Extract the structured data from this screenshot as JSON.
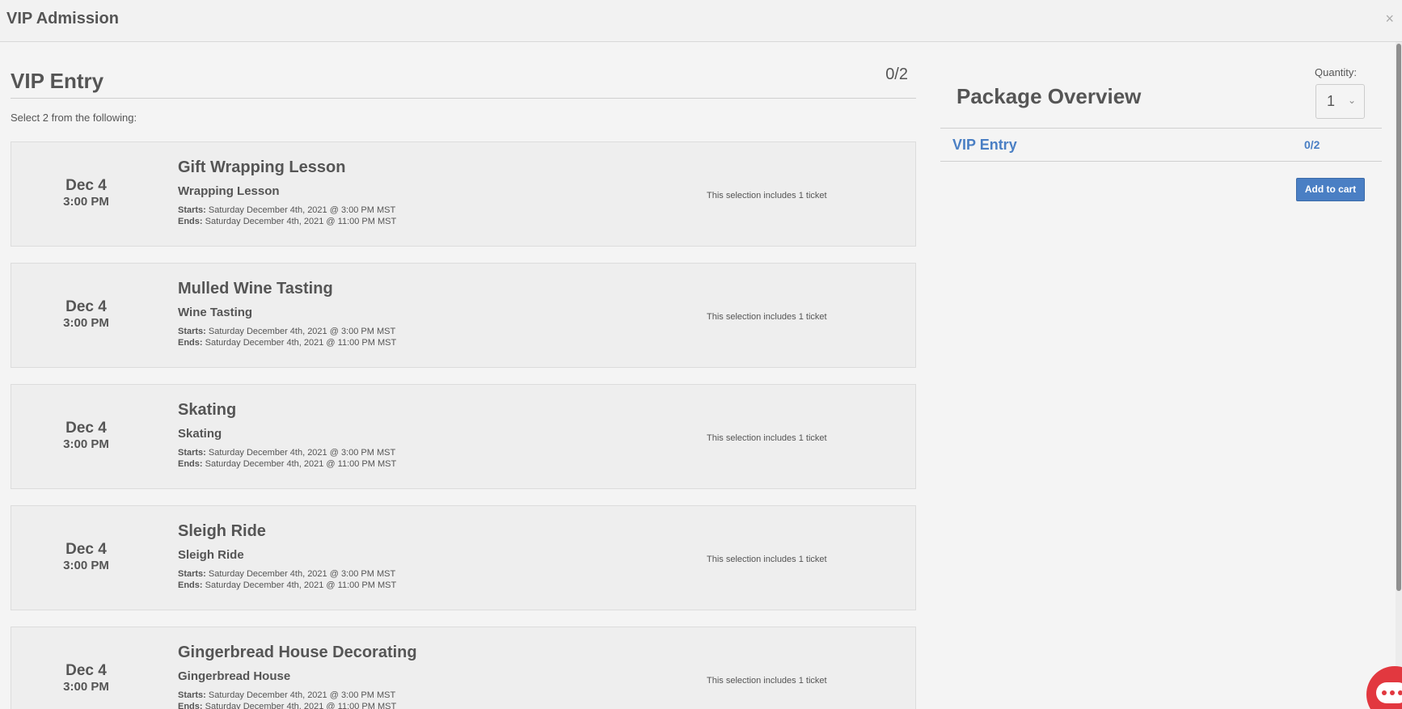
{
  "modal": {
    "title": "VIP Admission",
    "close_label": "×"
  },
  "section": {
    "title": "VIP Entry",
    "count": "0/2",
    "hint": "Select 2 from the following:"
  },
  "events": [
    {
      "date": "Dec 4",
      "time": "3:00 PM",
      "name": "Gift Wrapping Lesson",
      "subtitle": "Wrapping Lesson",
      "starts_label": "Starts:",
      "starts": "Saturday December 4th, 2021 @ 3:00 PM MST",
      "ends_label": "Ends:",
      "ends": "Saturday December 4th, 2021 @ 11:00 PM MST",
      "includes": "This selection includes 1 ticket"
    },
    {
      "date": "Dec 4",
      "time": "3:00 PM",
      "name": "Mulled Wine Tasting",
      "subtitle": "Wine Tasting",
      "starts_label": "Starts:",
      "starts": "Saturday December 4th, 2021 @ 3:00 PM MST",
      "ends_label": "Ends:",
      "ends": "Saturday December 4th, 2021 @ 11:00 PM MST",
      "includes": "This selection includes 1 ticket"
    },
    {
      "date": "Dec 4",
      "time": "3:00 PM",
      "name": "Skating",
      "subtitle": "Skating",
      "starts_label": "Starts:",
      "starts": "Saturday December 4th, 2021 @ 3:00 PM MST",
      "ends_label": "Ends:",
      "ends": "Saturday December 4th, 2021 @ 11:00 PM MST",
      "includes": "This selection includes 1 ticket"
    },
    {
      "date": "Dec 4",
      "time": "3:00 PM",
      "name": "Sleigh Ride",
      "subtitle": "Sleigh Ride",
      "starts_label": "Starts:",
      "starts": "Saturday December 4th, 2021 @ 3:00 PM MST",
      "ends_label": "Ends:",
      "ends": "Saturday December 4th, 2021 @ 11:00 PM MST",
      "includes": "This selection includes 1 ticket"
    },
    {
      "date": "Dec 4",
      "time": "3:00 PM",
      "name": "Gingerbread House Decorating",
      "subtitle": "Gingerbread House",
      "starts_label": "Starts:",
      "starts": "Saturday December 4th, 2021 @ 3:00 PM MST",
      "ends_label": "Ends:",
      "ends": "Saturday December 4th, 2021 @ 11:00 PM MST",
      "includes": "This selection includes 1 ticket"
    }
  ],
  "overview": {
    "title": "Package Overview",
    "quantity_label": "Quantity:",
    "quantity_value": "1",
    "item_name": "VIP Entry",
    "item_count": "0/2",
    "add_to_cart": "Add to cart"
  },
  "icons": {
    "close": "close-icon",
    "chevron": "chevron-down-icon",
    "chat": "chat-icon"
  },
  "colors": {
    "accent": "#4a7fc4",
    "chat": "#e2383f"
  }
}
